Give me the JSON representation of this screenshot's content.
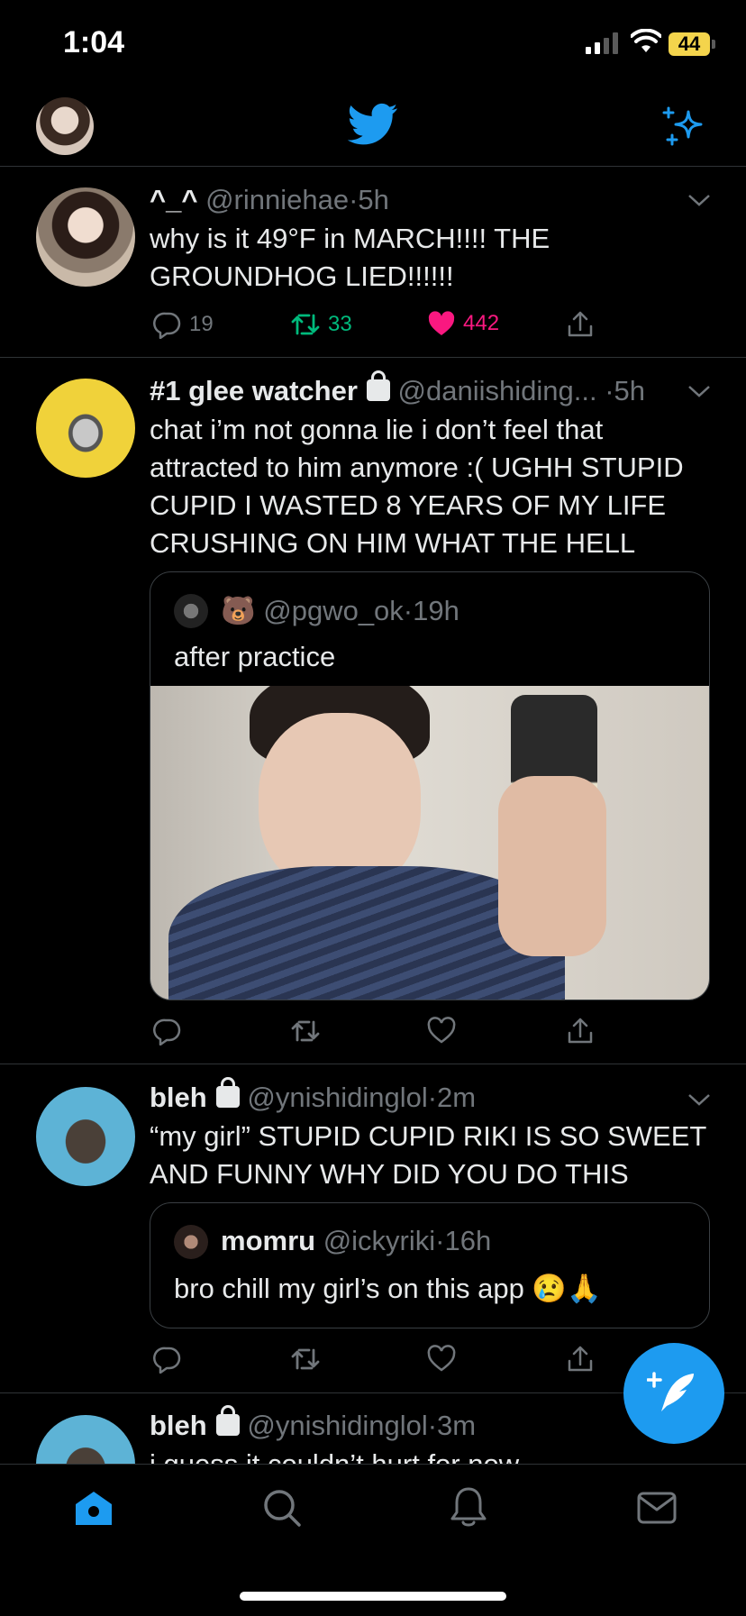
{
  "status_bar": {
    "time": "1:04",
    "battery": "44"
  },
  "header": {
    "profile_icon": "profile-avatar",
    "logo_icon": "twitter-bird-icon",
    "sparkle_icon": "sparkle-icon",
    "brand_color": "#1d9bf0"
  },
  "tweets": [
    {
      "name": "^_^",
      "handle": "@rinniehae",
      "time": "5h",
      "text": "why is it 49°F in MARCH!!!! THE GROUNDHOG LIED!!!!!!",
      "replies": "19",
      "retweets": "33",
      "likes": "442",
      "retweeted": true,
      "liked": true
    },
    {
      "name": "#1 glee watcher",
      "handle": "@daniishiding...",
      "time": "5h",
      "text": "chat i’m not gonna lie i don’t feel that attracted to him anymore :( UGHH STUPID CUPID I WASTED 8 YEARS OF MY LIFE CRUSHING ON HIM WHAT THE HELL",
      "quote": {
        "name_emoji": "🐻",
        "handle": "@pgwo_ok",
        "time": "19h",
        "text": "after practice"
      }
    },
    {
      "name": "bleh",
      "handle": "@ynishidinglol",
      "time": "2m",
      "text": "“my girl” STUPID CUPID RIKI IS SO SWEET AND FUNNY WHY DID YOU DO THIS",
      "quote": {
        "name": "momru",
        "handle": "@ickyriki",
        "time": "16h",
        "text": "bro chill my girl’s on this app 😢🙏"
      }
    },
    {
      "name": "bleh",
      "handle": "@ynishidinglol",
      "time": "3m",
      "text": "i guess it couldn’t hurt for now"
    }
  ],
  "separator": "·",
  "colors": {
    "retweet": "#00ba7c",
    "like": "#f91880",
    "muted": "#71767b"
  },
  "nav": [
    "home-icon",
    "search-icon",
    "notifications-icon",
    "messages-icon"
  ]
}
